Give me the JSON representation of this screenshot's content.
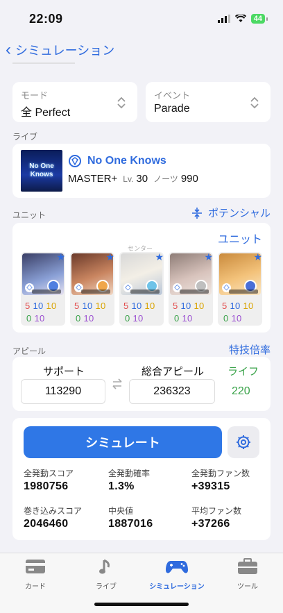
{
  "status": {
    "time": "22:09",
    "battery": "44"
  },
  "nav": {
    "title": "シミュレーション"
  },
  "mode": {
    "label": "モード",
    "value": "全 Perfect"
  },
  "event": {
    "label": "イベント",
    "value": "Parade"
  },
  "live": {
    "section": "ライブ",
    "jacket_line1": "No One",
    "jacket_line2": "Knows",
    "title": "No One Knows",
    "difficulty": "MASTER+",
    "lv_label": "Lv.",
    "level": "30",
    "notes_label": "ノーツ",
    "notes": "990"
  },
  "unit": {
    "section": "ユニット",
    "potential_link": "ポテンシャル",
    "unit_link": "ユニット",
    "center_label": "センター",
    "members": [
      {
        "vo": "5",
        "da": "10",
        "vi": "10",
        "sk": "0",
        "life": "10"
      },
      {
        "vo": "5",
        "da": "10",
        "vi": "10",
        "sk": "0",
        "life": "10"
      },
      {
        "vo": "5",
        "da": "10",
        "vi": "10",
        "sk": "0",
        "life": "10"
      },
      {
        "vo": "5",
        "da": "10",
        "vi": "10",
        "sk": "0",
        "life": "10"
      },
      {
        "vo": "5",
        "da": "10",
        "vi": "10",
        "sk": "0",
        "life": "10"
      }
    ]
  },
  "appeal": {
    "section": "アピール",
    "skill_multiplier_link": "特技倍率",
    "support_label": "サポート",
    "support_value": "113290",
    "total_label": "総合アピール",
    "total_value": "236323",
    "life_label": "ライフ",
    "life_value": "220"
  },
  "simulate": {
    "button": "シミュレート",
    "stats": [
      {
        "label": "全発動スコア",
        "value": "1980756"
      },
      {
        "label": "全発動確率",
        "value": "1.3%"
      },
      {
        "label": "全発動ファン数",
        "value": "+39315"
      },
      {
        "label": "巻き込みスコア",
        "value": "2046460"
      },
      {
        "label": "中央値",
        "value": "1887016"
      },
      {
        "label": "平均ファン数",
        "value": "+37266"
      }
    ]
  },
  "tabs": [
    {
      "label": "カード",
      "icon": "card-icon"
    },
    {
      "label": "ライブ",
      "icon": "music-note-icon"
    },
    {
      "label": "シミュレーション",
      "icon": "gamepad-icon"
    },
    {
      "label": "ツール",
      "icon": "toolbox-icon"
    }
  ],
  "colors": {
    "accent": "#2f6bde",
    "button": "#2f77e6",
    "life": "#3aa34a"
  }
}
